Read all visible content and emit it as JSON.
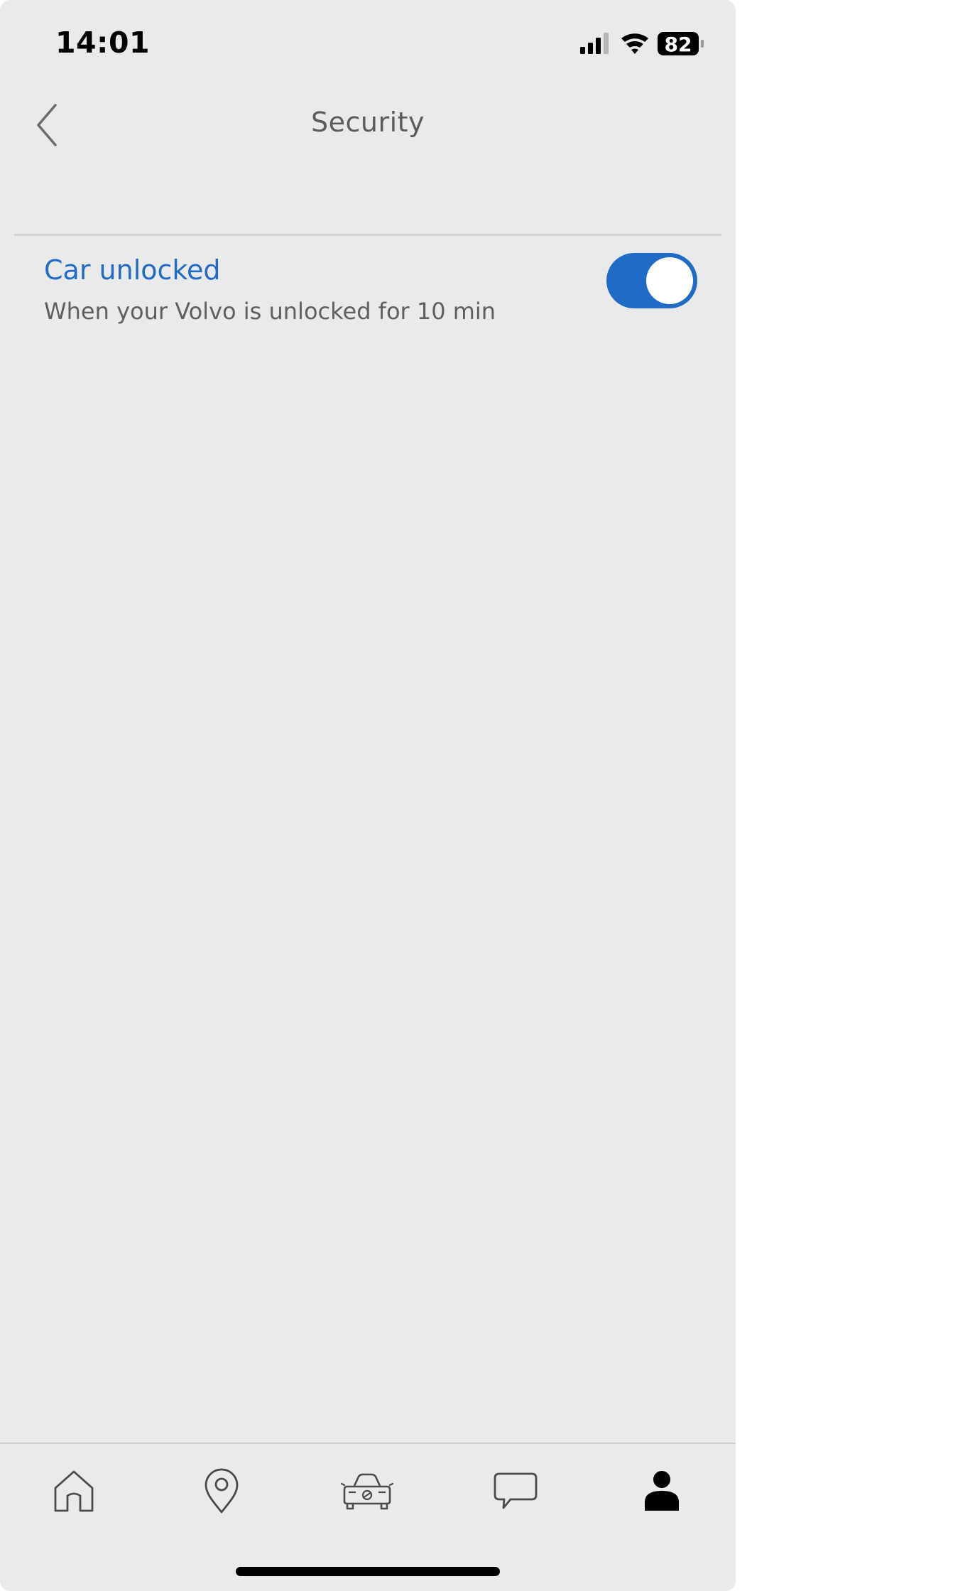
{
  "status_bar": {
    "time": "14:01",
    "battery_level": "82",
    "icons": [
      "cellular-signal-icon",
      "wifi-icon",
      "battery-icon"
    ]
  },
  "header": {
    "title": "Security",
    "back_icon": "chevron-left-icon"
  },
  "settings": [
    {
      "title": "Car unlocked",
      "description": "When your Volvo is unlocked for 10 min",
      "enabled": true
    }
  ],
  "tab_bar": {
    "items": [
      {
        "icon": "home-icon",
        "active": false
      },
      {
        "icon": "map-pin-icon",
        "active": false
      },
      {
        "icon": "car-icon",
        "active": false
      },
      {
        "icon": "chat-bubble-icon",
        "active": false
      },
      {
        "icon": "profile-icon",
        "active": true
      }
    ]
  },
  "colors": {
    "background": "#eaeaea",
    "accent": "#1f6bc6",
    "title_text": "#5c5c5c",
    "secondary_text": "#5f5f5f"
  }
}
